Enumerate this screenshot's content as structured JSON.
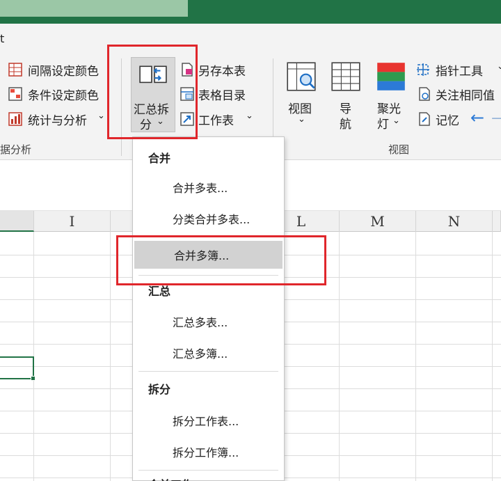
{
  "ribbon": {
    "partial_tab": "t",
    "left_group": {
      "items": [
        {
          "label": "间隔设定颜色",
          "icon": "grid-color-icon"
        },
        {
          "label": "条件设定颜色",
          "icon": "conditional-color-icon"
        },
        {
          "label": "统计与分析",
          "icon": "statistics-icon",
          "has_dropdown": true
        }
      ],
      "group_label": "据分析"
    },
    "merge_split_button": {
      "label_line1": "汇总拆",
      "label_line2": "分",
      "icon": "merge-split-icon"
    },
    "sheet_group": {
      "items": [
        {
          "label": "另存本表",
          "icon": "save-sheet-icon"
        },
        {
          "label": "表格目录",
          "icon": "table-directory-icon"
        },
        {
          "label": "工作表",
          "icon": "worksheet-icon",
          "has_dropdown": true
        }
      ]
    },
    "view_group": {
      "buttons": [
        {
          "label_line1": "视图",
          "label_line2": "",
          "icon": "view-icon",
          "has_dropdown": true
        },
        {
          "label_line1": "导",
          "label_line2": "航",
          "icon": "navigation-icon"
        },
        {
          "label_line1": "聚光",
          "label_line2": "灯",
          "icon": "spotlight-icon",
          "has_dropdown": true
        }
      ],
      "side_items": [
        {
          "label": "指针工具",
          "icon": "pointer-tool-icon"
        },
        {
          "label": "关注相同值",
          "icon": "watch-same-value-icon"
        },
        {
          "label": "记忆",
          "icon": "memory-icon"
        }
      ],
      "group_label": "视图"
    }
  },
  "grid": {
    "columns": [
      "I",
      "",
      "L",
      "M",
      "N"
    ]
  },
  "menu": {
    "sections": [
      {
        "header": "合并",
        "items": [
          "合并多表...",
          "分类合并多表...",
          "合并多簿..."
        ]
      },
      {
        "header": "汇总",
        "items": [
          "汇总多表...",
          "汇总多簿..."
        ]
      },
      {
        "header": "拆分",
        "items": [
          "拆分工作表...",
          "拆分工作簿..."
        ]
      }
    ],
    "highlighted_item": "合并多簿...",
    "partial_next_header": "合并工作"
  },
  "colors": {
    "title_bar": "#217346",
    "highlight_box": "#e0262b",
    "menu_hover": "#d2d2d2",
    "selection_border": "#217346"
  }
}
